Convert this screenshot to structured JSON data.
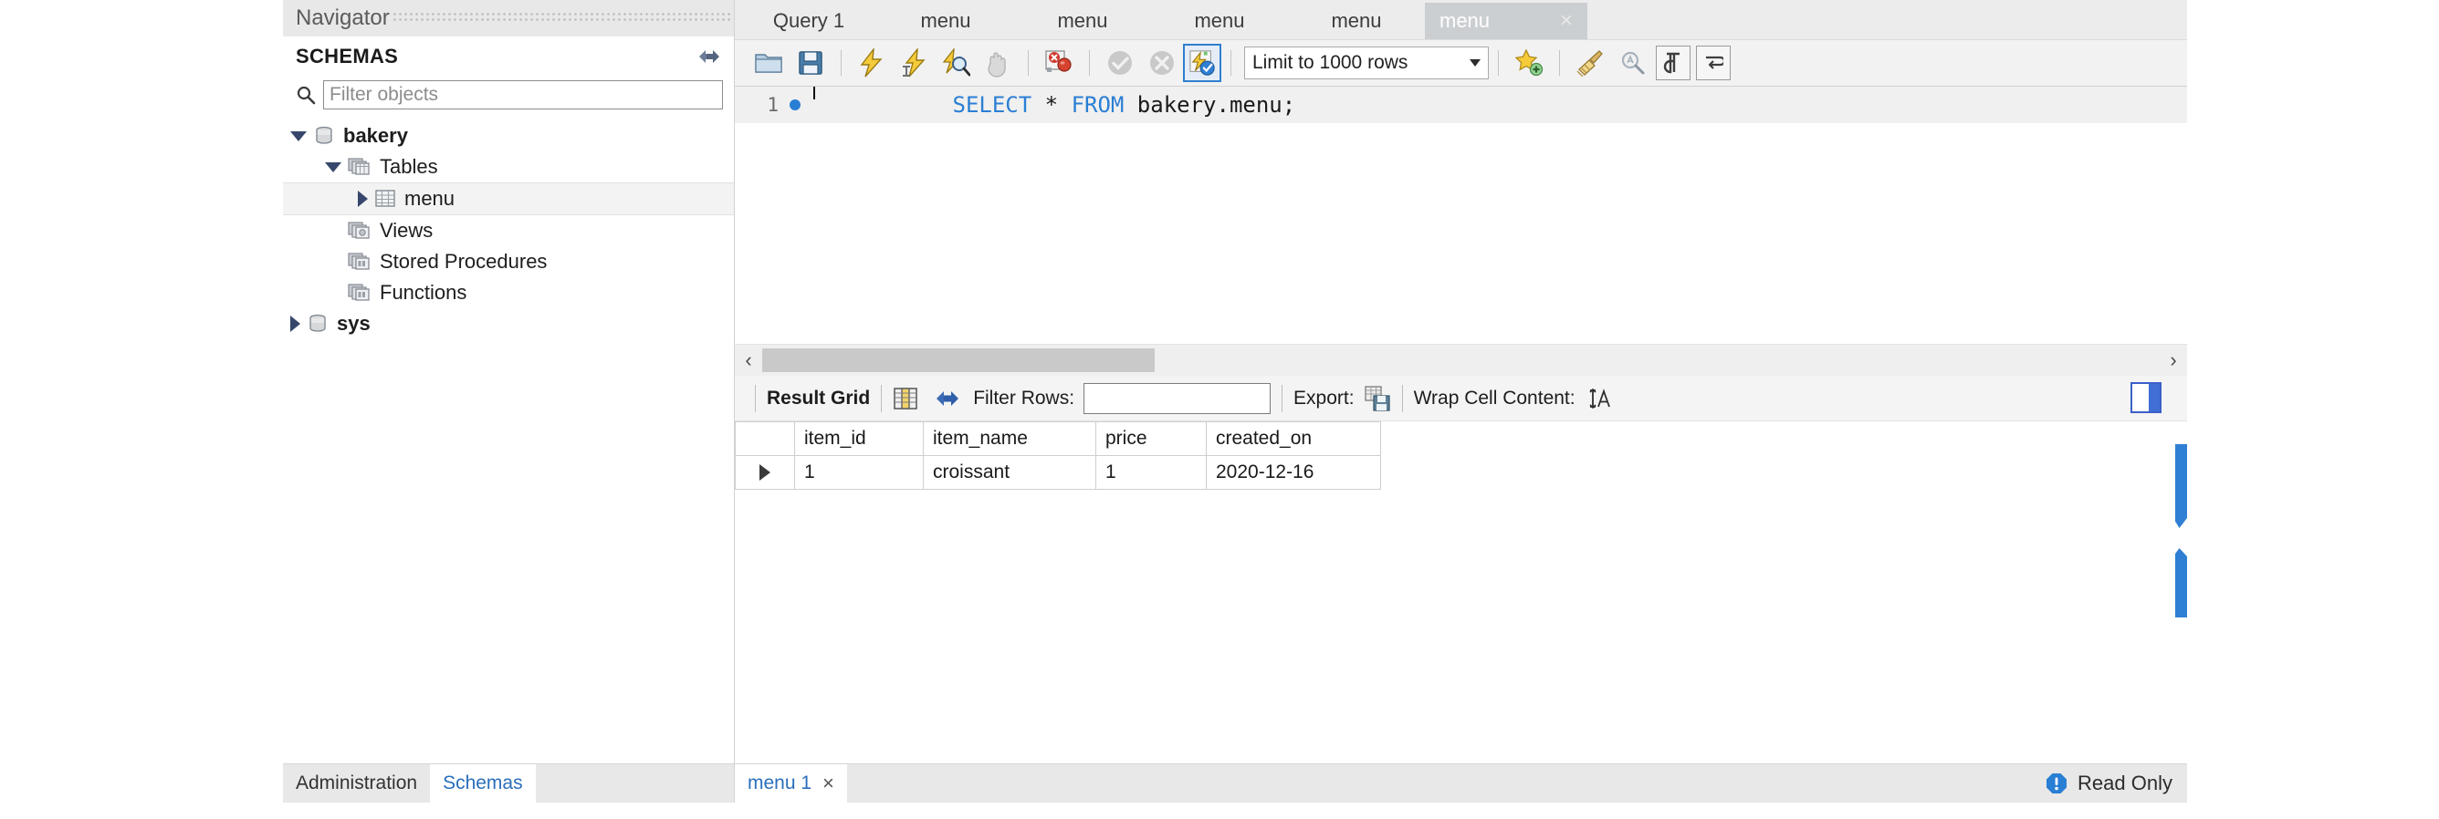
{
  "navigator": {
    "title": "Navigator",
    "schemas_label": "SCHEMAS",
    "refresh_icon": "refresh-schemas-icon",
    "filter": {
      "placeholder": "Filter objects",
      "value": ""
    },
    "tree": [
      {
        "label": "bakery",
        "icon": "database-icon",
        "indent": 0,
        "expander": "down",
        "bold": true,
        "selected": false
      },
      {
        "label": "Tables",
        "icon": "folder-tables-icon",
        "indent": 1,
        "expander": "down",
        "bold": false,
        "selected": false
      },
      {
        "label": "menu",
        "icon": "table-icon",
        "indent": 2,
        "expander": "right",
        "bold": false,
        "selected": true
      },
      {
        "label": "Views",
        "icon": "folder-views-icon",
        "indent": 1,
        "expander": "none",
        "bold": false,
        "selected": false
      },
      {
        "label": "Stored Procedures",
        "icon": "folder-routines-icon",
        "indent": 1,
        "expander": "none",
        "bold": false,
        "selected": false
      },
      {
        "label": "Functions",
        "icon": "folder-routines-icon",
        "indent": 1,
        "expander": "none",
        "bold": false,
        "selected": false
      },
      {
        "label": "sys",
        "icon": "database-icon",
        "indent": 0,
        "expander": "right",
        "bold": false,
        "selected": false
      }
    ],
    "bottom_tabs": [
      {
        "label": "Administration",
        "active": false
      },
      {
        "label": "Schemas",
        "active": true
      }
    ]
  },
  "editor": {
    "tabs": [
      {
        "label": "Query 1",
        "active": false,
        "closable": false
      },
      {
        "label": "menu",
        "active": false,
        "closable": false
      },
      {
        "label": "menu",
        "active": false,
        "closable": false
      },
      {
        "label": "menu",
        "active": false,
        "closable": false
      },
      {
        "label": "menu",
        "active": false,
        "closable": false
      },
      {
        "label": "menu",
        "active": true,
        "closable": true,
        "close_label": "×"
      }
    ],
    "toolbar": {
      "open_sql_icon": "open-sql-file-icon",
      "save_sql_icon": "save-sql-file-icon",
      "execute_icon": "execute-statement-lightning-icon",
      "execute_current_icon": "execute-current-statement-icon",
      "explain_icon": "explain-query-magnifier-icon",
      "stop_icon": "stop-execution-hand-icon",
      "toggle_stop_on_error_icon": "toggle-stop-on-error-icon",
      "commit_icon": "commit-check-icon",
      "rollback_icon": "rollback-cross-icon",
      "autocommit_icon": "toggle-autocommit-icon",
      "limit_value": "Limit to 1000 rows",
      "snippets_icon": "save-snippet-star-icon",
      "beautify_icon": "beautify-sql-broom-icon",
      "find_icon": "find-magnifier-icon",
      "invisible_chars_icon": "toggle-invisible-characters-icon",
      "wrap_lines_icon": "toggle-word-wrap-icon"
    },
    "sql": {
      "line_number": "1",
      "breakpoint_marker": "statement-marker-dot",
      "tokens": [
        {
          "text": "SELECT",
          "type": "keyword"
        },
        {
          "text": " * ",
          "type": "plain"
        },
        {
          "text": "FROM",
          "type": "keyword"
        },
        {
          "text": " bakery.menu;",
          "type": "plain"
        }
      ]
    },
    "hscroll": {
      "left_arrow": "‹",
      "right_arrow": "›"
    }
  },
  "results": {
    "toolbar": {
      "result_grid_label": "Result Grid",
      "grid_view_icon": "grid-view-icon",
      "refresh_icon": "refresh-results-icon",
      "filter_rows_label": "Filter Rows:",
      "filter_rows_value": "",
      "export_label": "Export:",
      "export_icon": "export-recordset-icon",
      "wrap_cell_label": "Wrap Cell Content:",
      "wrap_cell_icon": "wrap-cell-content-icon",
      "panel_toggle_icon": "toggle-sidebar-panel-icon"
    },
    "grid": {
      "columns": [
        "item_id",
        "item_name",
        "price",
        "created_on"
      ],
      "rows": [
        {
          "marker": "row-selector-arrow",
          "cells": [
            "1",
            "croissant",
            "1",
            "2020-12-16"
          ]
        }
      ]
    },
    "statusbar": {
      "result_tab_label": "menu 1",
      "result_tab_close": "×",
      "readonly_icon": "read-only-info-icon",
      "readonly_label": "Read Only"
    }
  },
  "colors": {
    "accent_blue": "#2a7fd4",
    "link_blue": "#2a6ebb",
    "tree_arrow": "#37476b",
    "active_tab_bg": "#cccfd2",
    "panel_bg": "#ececed",
    "toolbar_bg": "#f2f2f2"
  }
}
